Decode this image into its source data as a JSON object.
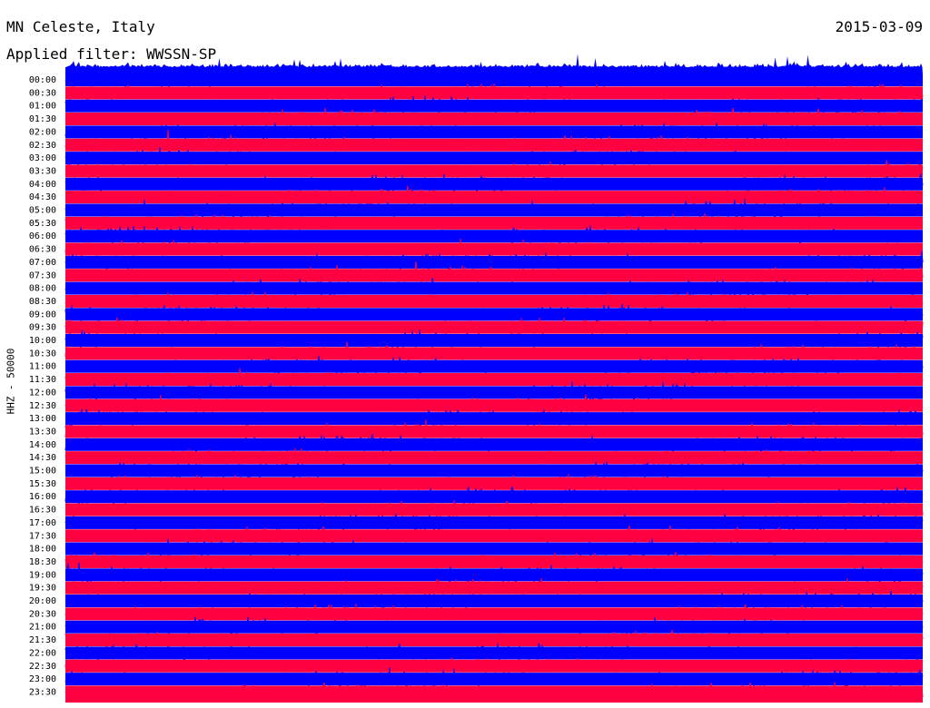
{
  "header": {
    "station": "MN Celeste, Italy",
    "date": "2015-03-09",
    "filter": "Applied filter: WWSSN-SP"
  },
  "chart_data": {
    "type": "line",
    "title": "MN Celeste, Italy",
    "ylabel": "HHZ - 50000",
    "time_labels": [
      "00:00",
      "00:30",
      "01:00",
      "01:30",
      "02:00",
      "02:30",
      "03:00",
      "03:30",
      "04:00",
      "04:30",
      "05:00",
      "05:30",
      "06:00",
      "06:30",
      "07:00",
      "07:30",
      "08:00",
      "08:30",
      "09:00",
      "09:30",
      "10:00",
      "10:30",
      "11:00",
      "11:30",
      "12:00",
      "12:30",
      "13:00",
      "13:30",
      "14:00",
      "14:30",
      "15:00",
      "15:30",
      "16:00",
      "16:30",
      "17:00",
      "17:30",
      "18:00",
      "18:30",
      "19:00",
      "19:30",
      "20:00",
      "20:30",
      "21:00",
      "21:30",
      "22:00",
      "22:30",
      "23:00",
      "23:30"
    ],
    "trace_colors": [
      "#0000ff",
      "#ff0040"
    ],
    "grid": false
  }
}
